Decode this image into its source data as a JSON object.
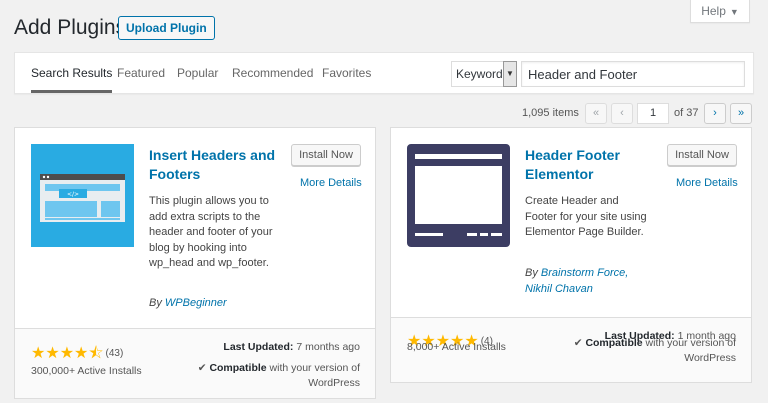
{
  "header": {
    "title": "Add Plugins",
    "upload_label": "Upload Plugin",
    "help_label": "Help"
  },
  "tabs": [
    {
      "label": "Search Results",
      "active": true
    },
    {
      "label": "Featured"
    },
    {
      "label": "Popular"
    },
    {
      "label": "Recommended"
    },
    {
      "label": "Favorites"
    }
  ],
  "search": {
    "type_label": "Keyword",
    "value": "Header and Footer"
  },
  "pagination": {
    "items_count": "1,095 items",
    "first": "«",
    "prev": "‹",
    "current_page": "1",
    "of_label": "of 37",
    "next": "›",
    "last": "»"
  },
  "plugins": [
    {
      "name": "Insert Headers and Footers",
      "install_label": "Install Now",
      "more_details_label": "More Details",
      "description": "This plugin allows you to add extra scripts to the header and footer of your blog by hooking into wp_head and wp_footer.",
      "author_prefix": "By",
      "author": "WPBeginner",
      "stars": "★★★★⯪",
      "rating_count": "(43)",
      "last_updated_label": "Last Updated:",
      "last_updated_value": "7 months ago",
      "active_installs": "300,000+ Active Installs",
      "compat_check": "✔",
      "compat_strong": "Compatible",
      "compat_rest": "with your version of WordPress",
      "icon": "code-page-icon",
      "icon_bg": "#29abe2"
    },
    {
      "name": "Header Footer Elementor",
      "install_label": "Install Now",
      "more_details_label": "More Details",
      "description": "Create Header and Footer for your site using Elementor Page Builder.",
      "author_prefix": "By",
      "author": "Brainstorm Force, Nikhil Chavan",
      "stars": "★★★★★",
      "rating_count": "(4)",
      "last_updated_label": "Last Updated:",
      "last_updated_value": "1 month ago",
      "active_installs": "8,000+ Active Installs",
      "compat_check": "✔",
      "compat_strong": "Compatible",
      "compat_rest": "with your version of WordPress",
      "icon": "layout-icon",
      "icon_bg": "#3c3d63"
    }
  ],
  "colors": {
    "link": "#0073aa",
    "star": "#ffb900"
  }
}
